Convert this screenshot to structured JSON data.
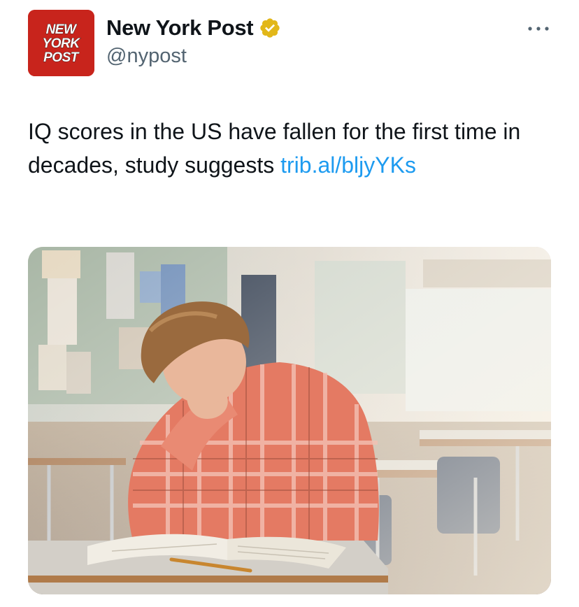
{
  "author": {
    "display_name": "New York Post",
    "handle": "@nypost",
    "verified": true,
    "avatar_logo_text": [
      "NEW",
      "YORK",
      "POST"
    ],
    "avatar_color": "#c8241c",
    "verified_color": "#e2b719"
  },
  "menu": {
    "icon": "more-options-icon"
  },
  "tweet": {
    "text": "IQ scores in the US have fallen for the first time in decades, study suggests ",
    "link": "trib.al/bljyYKs"
  },
  "media": {
    "description_icon": "photo",
    "scene": "classroom"
  },
  "colors": {
    "link": "#1d9bf0",
    "secondary_text": "#536471",
    "primary_text": "#0f1419"
  }
}
